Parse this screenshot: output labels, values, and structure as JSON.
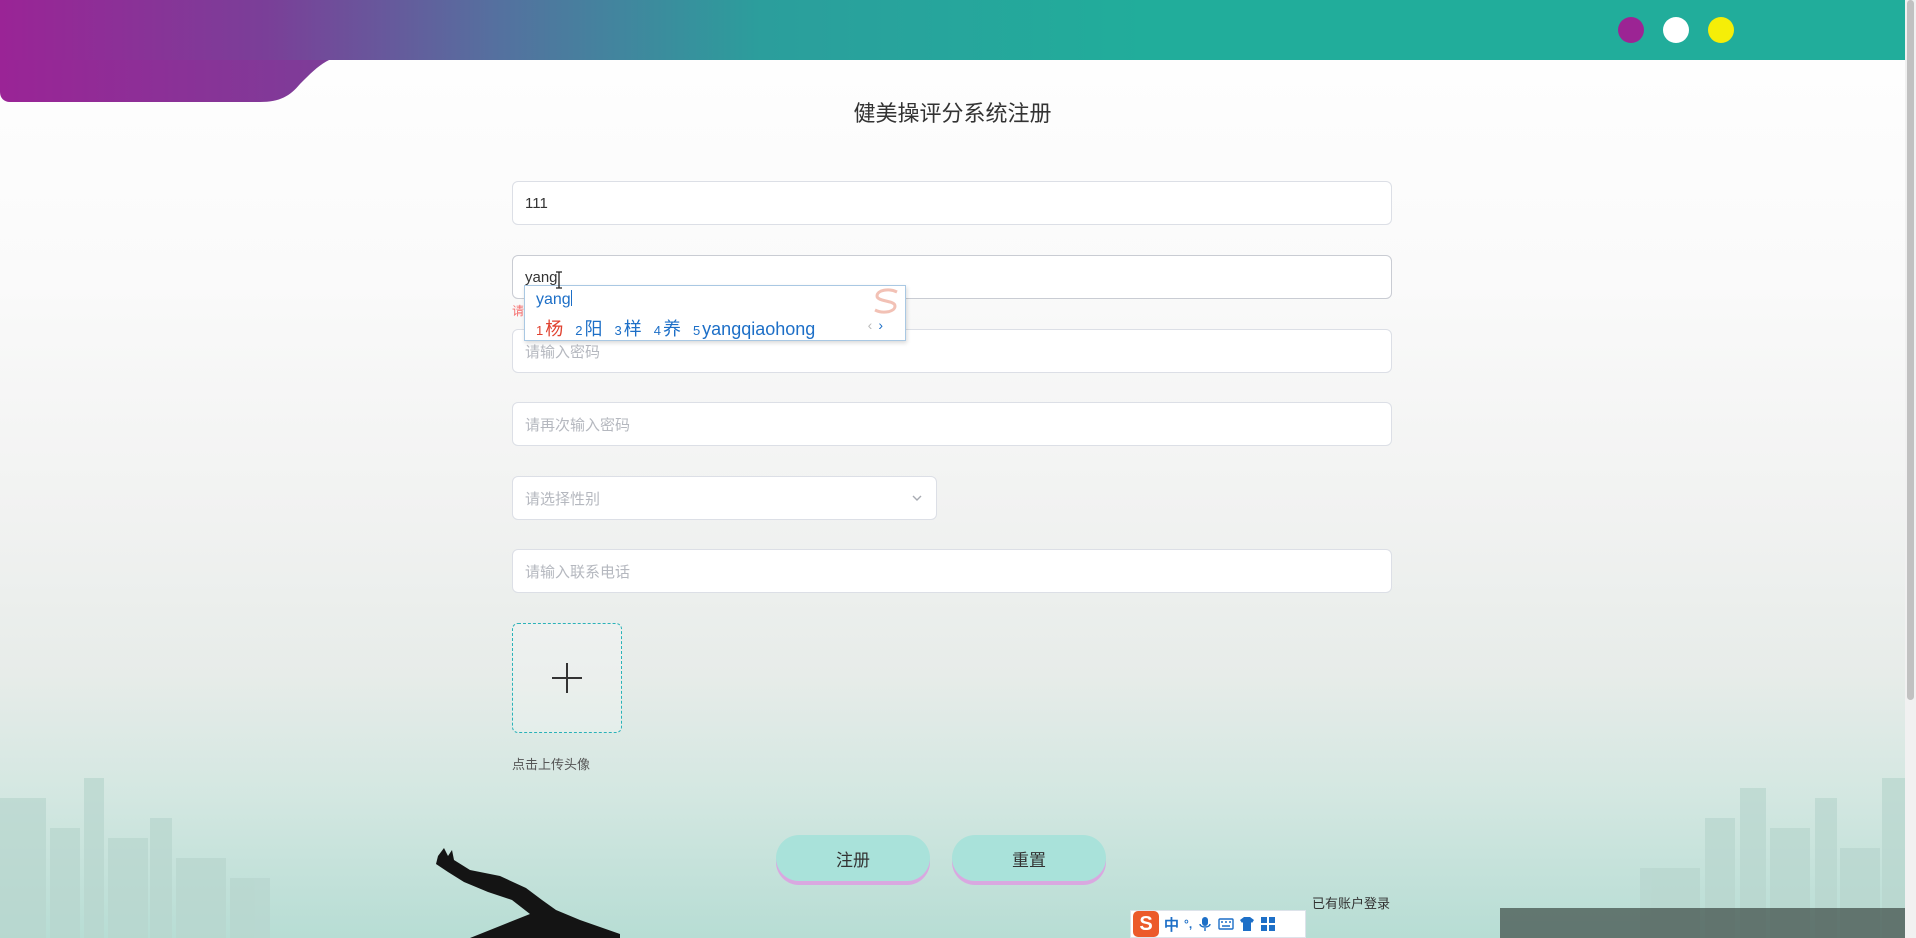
{
  "page": {
    "title": "健美操评分系统注册"
  },
  "header": {
    "theme_dots": [
      {
        "name": "purple",
        "color": "#9c2494"
      },
      {
        "name": "white",
        "color": "#ffffff"
      },
      {
        "name": "yellow",
        "color": "#f5ee08"
      }
    ],
    "gradient_colors": [
      "#9a2496",
      "#21ad9b"
    ]
  },
  "form": {
    "username": {
      "value": "111",
      "placeholder": ""
    },
    "name": {
      "value": "yang",
      "error": "请"
    },
    "password": {
      "placeholder": "请输入密码"
    },
    "password_confirm": {
      "placeholder": "请再次输入密码"
    },
    "gender": {
      "placeholder": "请选择性别"
    },
    "phone": {
      "placeholder": "请输入联系电话"
    },
    "avatar": {
      "hint": "点击上传头像",
      "icon": "plus-icon"
    },
    "register_label": "注册",
    "reset_label": "重置",
    "login_link": "已有账户登录"
  },
  "ime": {
    "composition": "yang",
    "candidates": [
      {
        "num": "1",
        "text": "杨"
      },
      {
        "num": "2",
        "text": "阳"
      },
      {
        "num": "3",
        "text": "样"
      },
      {
        "num": "4",
        "text": "养"
      },
      {
        "num": "5",
        "text": "yangqiaohong"
      }
    ],
    "prev": "‹",
    "next": "›"
  },
  "ime_toolbar": {
    "logo": "S",
    "mode": "中",
    "punct": "°,",
    "icons": [
      "microphone-icon",
      "keyboard-icon",
      "skin-icon",
      "toolbox-icon"
    ]
  },
  "colors": {
    "accent": "#21ad9b",
    "button_bg": "#a9e2da",
    "button_shadow": "#d9a8e0",
    "error": "#f56c6c",
    "ime_blue": "#1d6fc7",
    "ime_red": "#e0412f"
  }
}
